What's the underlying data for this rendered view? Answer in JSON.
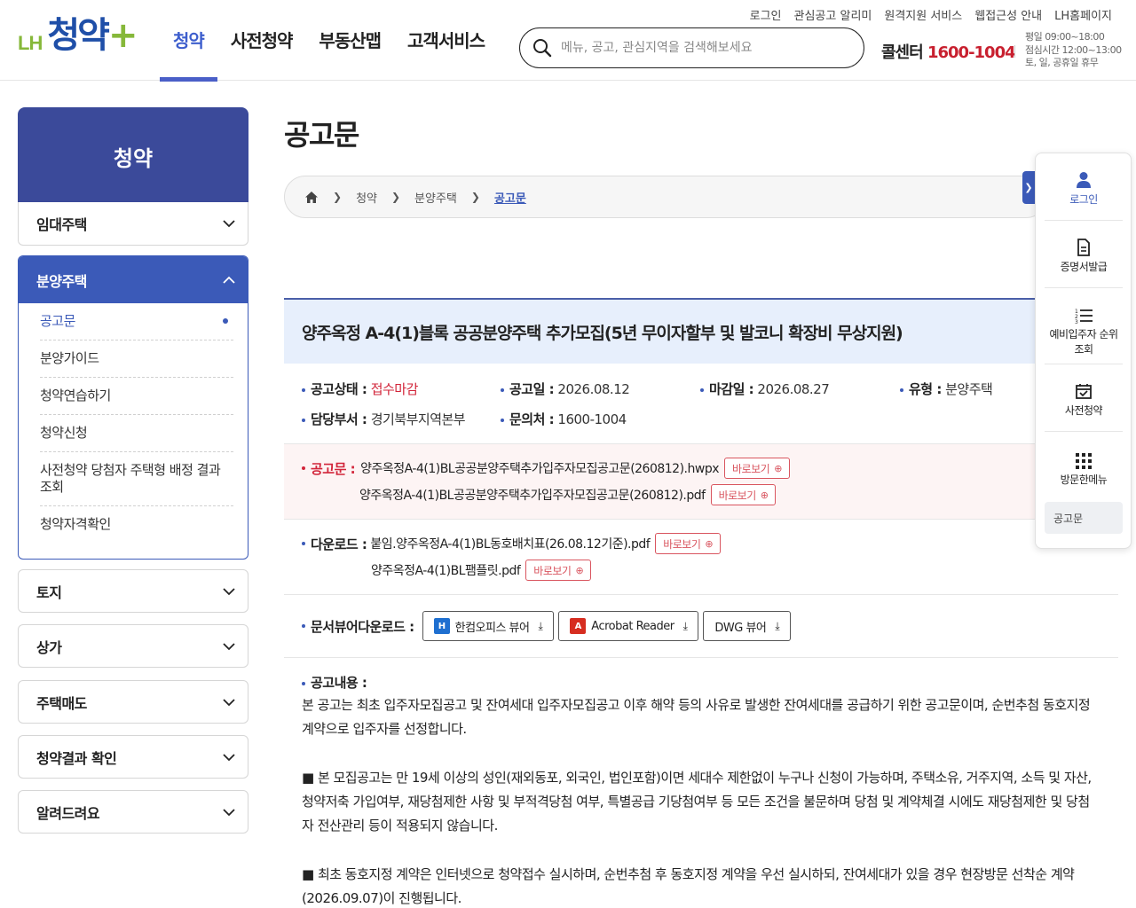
{
  "header": {
    "logo_prefix": "LH",
    "logo_name": "청약",
    "logo_plus": "+",
    "nav": [
      "청약",
      "사전청약",
      "부동산맵",
      "고객서비스"
    ],
    "search_placeholder": "메뉴, 공고, 관심지역을 검색해보세요",
    "util_links": [
      "로그인",
      "관심공고 알리미",
      "원격지원 서비스",
      "웹접근성 안내",
      "LH홈페이지"
    ],
    "callcenter_label": "콜센터",
    "callcenter_number": "1600-1004",
    "hours": [
      "평일 09:00~18:00",
      "점심시간 12:00~13:00",
      "토, 일, 공휴일 휴무"
    ]
  },
  "sidebar": {
    "title": "청약",
    "items_before": [
      "임대주택"
    ],
    "open_section": "분양주택",
    "open_items": [
      "공고문",
      "분양가이드",
      "청약연습하기",
      "청약신청",
      "사전청약 당첨자 주택형 배정 결과 조회",
      "청약자격확인"
    ],
    "items_after": [
      "토지",
      "상가",
      "주택매도",
      "청약결과 확인",
      "알려드려요"
    ]
  },
  "page": {
    "title": "공고문",
    "breadcrumb": [
      "청약",
      "분양주택",
      "공고문"
    ]
  },
  "notice": {
    "title": "양주옥정 A-4(1)블록 공공분양주택 추가모집(5년 무이자할부 및 발코니 확장비 무상지원)",
    "status_label": "공고상태 :",
    "status_value": "접수마감",
    "post_date_label": "공고일 :",
    "post_date": "2026.08.12",
    "deadline_label": "마감일 :",
    "deadline": "2026.08.27",
    "type_label": "유형 :",
    "type_value": "분양주택",
    "dept_label": "담당부서 :",
    "dept_value": "경기북부지역본부",
    "contact_label": "문의처 :",
    "contact_value": "1600-1004",
    "announce_label": "공고문 :",
    "announce_files": [
      "양주옥정A-4(1)BL공공분양주택추가입주자모집공고문(260812).hwpx",
      "양주옥정A-4(1)BL공공분양주택추가입주자모집공고문(260812).pdf"
    ],
    "download_label": "다운로드 :",
    "download_files": [
      "붙임.양주옥정A-4(1)BL동호배치표(26.08.12기준).pdf",
      "양주옥정A-4(1)BL팸플릿.pdf"
    ],
    "view_button": "바로보기",
    "viewer_label": "문서뷰어다운로드 :",
    "viewers": [
      "한컴오피스 뷰어",
      "Acrobat Reader",
      "DWG 뷰어"
    ],
    "content_label": "공고내용 :",
    "content_p1": "본 공고는 최초 입주자모집공고 및 잔여세대 입주자모집공고 이후 해약 등의 사유로 발생한 잔여세대를 공급하기 위한 공고문이며, 순번추첨 동호지정 계약으로 입주자를 선정합니다.",
    "content_p2": "■ 본 모집공고는 만 19세 이상의 성인(재외동포, 외국인, 법인포함)이면 세대수 제한없이 누구나 신청이 가능하며, 주택소유, 거주지역, 소득 및 자산, 청약저축 가입여부, 재당첨제한 사항 및 부적격당첨 여부, 특별공급 기당첨여부 등 모든 조건을 불문하며 당첨 및 계약체결 시에도 재당첨제한 및 당첨자 전산관리 등이 적용되지 않습니다.",
    "content_p3": "■ 최초 동호지정 계약은 인터넷으로 청약접수 실시하며, 순번추첨 후 동호지정 계약을 우선 실시하되, 잔여세대가 있을 경우 현장방문 선착순 계약(2026.09.07)이 진행됩니다."
  },
  "quick_menu": {
    "items": [
      "로그인",
      "증명서발급",
      "예비입주자 순위 조회",
      "사전청약",
      "방문한메뉴"
    ],
    "recent": "공고문"
  },
  "colors": {
    "primary": "#3b5ab8",
    "sidebar_head": "#3b4a9a",
    "accent_red": "#d2253a",
    "logo_green": "#86b83a"
  }
}
